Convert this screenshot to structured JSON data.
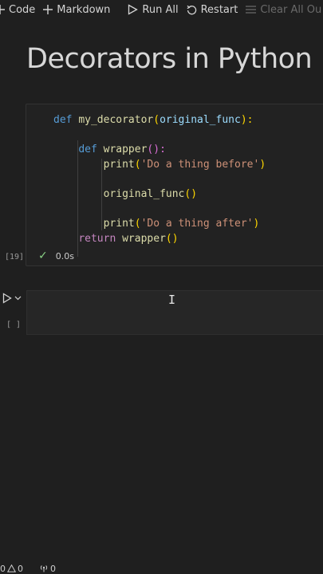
{
  "toolbar": {
    "code_label": "Code",
    "markdown_label": "Markdown",
    "run_all_label": "Run All",
    "restart_label": "Restart",
    "clear_label": "Clear All Ou"
  },
  "notebook": {
    "title": "Decorators in Python",
    "cell1": {
      "execution_count": "[19]",
      "status_time": "0.0s",
      "lines": {
        "l1": [
          "def",
          "my_decorator",
          "(",
          "original_func",
          "):"
        ],
        "l2": [
          "def",
          "wrapper",
          "():"
        ],
        "l3": [
          "print",
          "(",
          "'Do a thing before'",
          ")"
        ],
        "l4": [
          "original_func",
          "()"
        ],
        "l5": [
          "print",
          "(",
          "'Do a thing after'",
          ")"
        ],
        "l6": [
          "return",
          "wrapper",
          "()"
        ]
      }
    },
    "cell2": {
      "execution_count": "[ ]",
      "cursor_glyph": "I"
    }
  },
  "statusbar": {
    "errors": "0",
    "warnings": "0",
    "ports": "0"
  },
  "colors": {
    "background": "#1f1f1f",
    "keyword": "#569cd6",
    "control": "#c586c0",
    "function": "#dcdcaa",
    "string": "#ce9178",
    "success": "#89d185"
  }
}
